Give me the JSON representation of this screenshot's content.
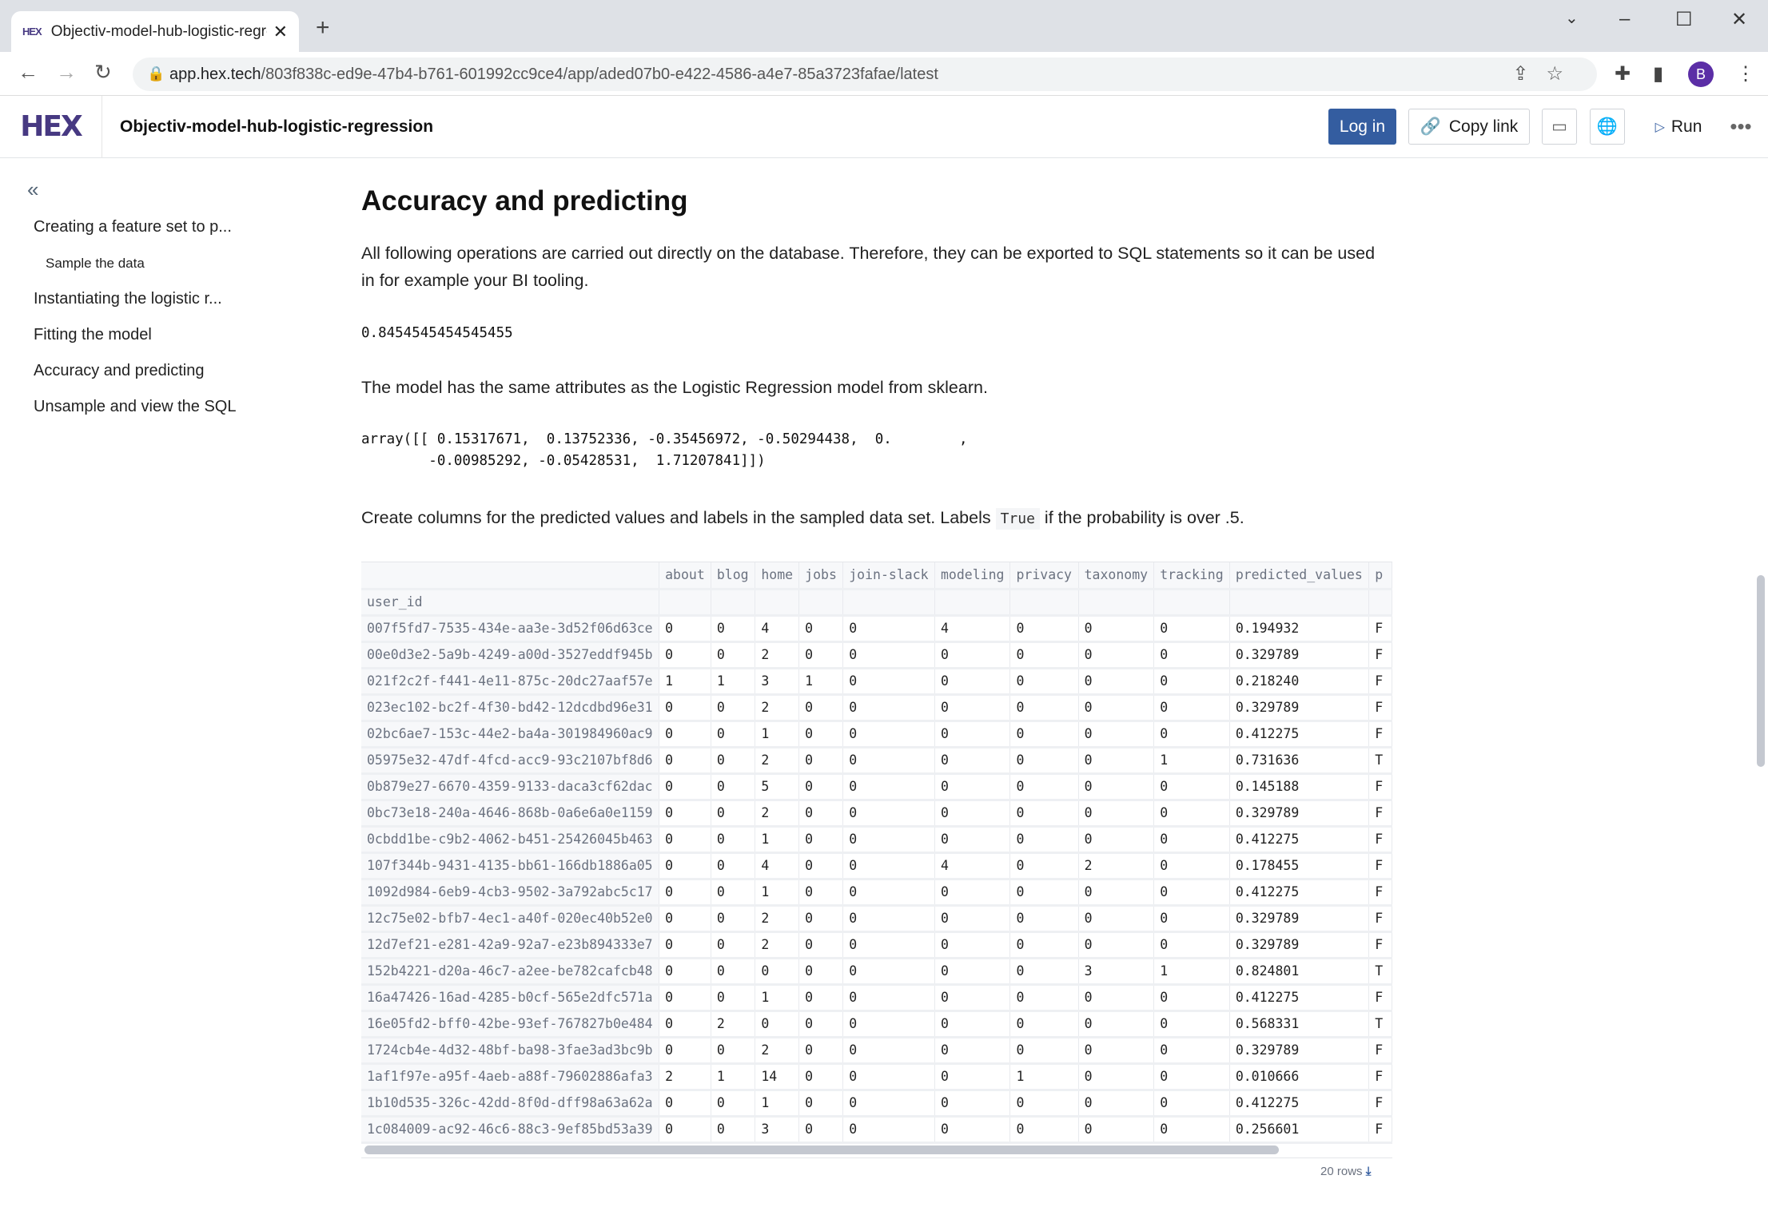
{
  "browser": {
    "tab_title": "Objectiv-model-hub-logistic-regression",
    "tab_favicon": "HEX",
    "url_host": "app.hex.tech",
    "url_path": "/803f838c-ed9e-47b4-b761-601992cc9ce4/app/aded07b0-e422-4586-a4e7-85a3723fafae/latest",
    "profile_initial": "B"
  },
  "app": {
    "logo": "HEX",
    "title": "Objectiv-model-hub-logistic-regression",
    "login": "Log in",
    "copy_link": "Copy link",
    "run": "Run",
    "accent": "#345da0"
  },
  "sidebar": {
    "items": [
      {
        "label": "Creating a feature set to p..."
      },
      {
        "label": "Sample the data"
      },
      {
        "label": "Instantiating the logistic r..."
      },
      {
        "label": "Fitting the model"
      },
      {
        "label": "Accuracy and predicting"
      },
      {
        "label": "Unsample and view the SQL"
      }
    ]
  },
  "main": {
    "heading": "Accuracy and predicting",
    "intro": "All following operations are carried out directly on the database. Therefore, they can be exported to SQL statements so it can be used in for example your BI tooling.",
    "accuracy": "0.8454545454545455",
    "model_text": "The model has the same attributes as the Logistic Regression model from sklearn.",
    "array_line1": "array([[ 0.15317671,  0.13752336, -0.35456972, -0.50294438,  0.        ,",
    "array_line2": "        -0.00985292, -0.05428531,  1.71207841]])",
    "create_pre": "Create columns for the predicted values and labels in the sampled data set. Labels ",
    "create_code": "True",
    "create_post": " if the probability is over .5.",
    "table": {
      "index_name": "user_id",
      "columns": [
        "about",
        "blog",
        "home",
        "jobs",
        "join-slack",
        "modeling",
        "privacy",
        "taxonomy",
        "tracking",
        "predicted_values",
        "p"
      ],
      "rows": [
        [
          "007f5fd7-7535-434e-aa3e-3d52f06d63ce",
          "0",
          "0",
          "4",
          "0",
          "0",
          "4",
          "0",
          "0",
          "0",
          "0.194932",
          "F"
        ],
        [
          "00e0d3e2-5a9b-4249-a00d-3527eddf945b",
          "0",
          "0",
          "2",
          "0",
          "0",
          "0",
          "0",
          "0",
          "0",
          "0.329789",
          "F"
        ],
        [
          "021f2c2f-f441-4e11-875c-20dc27aaf57e",
          "1",
          "1",
          "3",
          "1",
          "0",
          "0",
          "0",
          "0",
          "0",
          "0.218240",
          "F"
        ],
        [
          "023ec102-bc2f-4f30-bd42-12dcdbd96e31",
          "0",
          "0",
          "2",
          "0",
          "0",
          "0",
          "0",
          "0",
          "0",
          "0.329789",
          "F"
        ],
        [
          "02bc6ae7-153c-44e2-ba4a-301984960ac9",
          "0",
          "0",
          "1",
          "0",
          "0",
          "0",
          "0",
          "0",
          "0",
          "0.412275",
          "F"
        ],
        [
          "05975e32-47df-4fcd-acc9-93c2107bf8d6",
          "0",
          "0",
          "2",
          "0",
          "0",
          "0",
          "0",
          "0",
          "1",
          "0.731636",
          "T"
        ],
        [
          "0b879e27-6670-4359-9133-daca3cf62dac",
          "0",
          "0",
          "5",
          "0",
          "0",
          "0",
          "0",
          "0",
          "0",
          "0.145188",
          "F"
        ],
        [
          "0bc73e18-240a-4646-868b-0a6e6a0e1159",
          "0",
          "0",
          "2",
          "0",
          "0",
          "0",
          "0",
          "0",
          "0",
          "0.329789",
          "F"
        ],
        [
          "0cbdd1be-c9b2-4062-b451-25426045b463",
          "0",
          "0",
          "1",
          "0",
          "0",
          "0",
          "0",
          "0",
          "0",
          "0.412275",
          "F"
        ],
        [
          "107f344b-9431-4135-bb61-166db1886a05",
          "0",
          "0",
          "4",
          "0",
          "0",
          "4",
          "0",
          "2",
          "0",
          "0.178455",
          "F"
        ],
        [
          "1092d984-6eb9-4cb3-9502-3a792abc5c17",
          "0",
          "0",
          "1",
          "0",
          "0",
          "0",
          "0",
          "0",
          "0",
          "0.412275",
          "F"
        ],
        [
          "12c75e02-bfb7-4ec1-a40f-020ec40b52e0",
          "0",
          "0",
          "2",
          "0",
          "0",
          "0",
          "0",
          "0",
          "0",
          "0.329789",
          "F"
        ],
        [
          "12d7ef21-e281-42a9-92a7-e23b894333e7",
          "0",
          "0",
          "2",
          "0",
          "0",
          "0",
          "0",
          "0",
          "0",
          "0.329789",
          "F"
        ],
        [
          "152b4221-d20a-46c7-a2ee-be782cafcb48",
          "0",
          "0",
          "0",
          "0",
          "0",
          "0",
          "0",
          "3",
          "1",
          "0.824801",
          "T"
        ],
        [
          "16a47426-16ad-4285-b0cf-565e2dfc571a",
          "0",
          "0",
          "1",
          "0",
          "0",
          "0",
          "0",
          "0",
          "0",
          "0.412275",
          "F"
        ],
        [
          "16e05fd2-bff0-42be-93ef-767827b0e484",
          "0",
          "2",
          "0",
          "0",
          "0",
          "0",
          "0",
          "0",
          "0",
          "0.568331",
          "T"
        ],
        [
          "1724cb4e-4d32-48bf-ba98-3fae3ad3bc9b",
          "0",
          "0",
          "2",
          "0",
          "0",
          "0",
          "0",
          "0",
          "0",
          "0.329789",
          "F"
        ],
        [
          "1af1f97e-a95f-4aeb-a88f-79602886afa3",
          "2",
          "1",
          "14",
          "0",
          "0",
          "0",
          "1",
          "0",
          "0",
          "0.010666",
          "F"
        ],
        [
          "1b10d535-326c-42dd-8f0d-dff98a63a62a",
          "0",
          "0",
          "1",
          "0",
          "0",
          "0",
          "0",
          "0",
          "0",
          "0.412275",
          "F"
        ],
        [
          "1c084009-ac92-46c6-88c3-9ef85bd53a39",
          "0",
          "0",
          "3",
          "0",
          "0",
          "0",
          "0",
          "0",
          "0",
          "0.256601",
          "F"
        ]
      ],
      "row_count": "20 rows"
    }
  }
}
